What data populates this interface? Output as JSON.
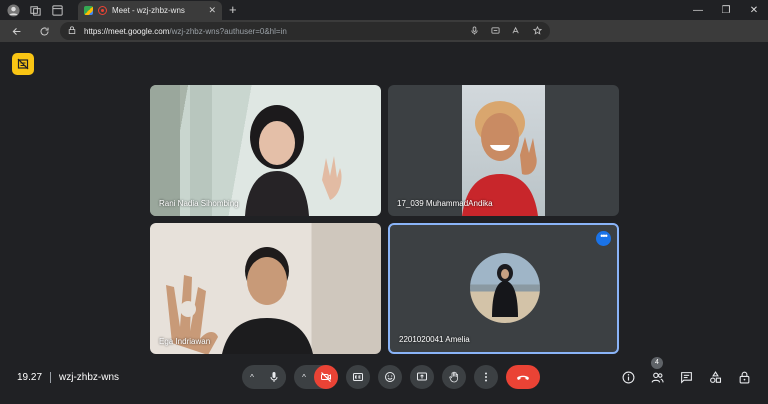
{
  "browser": {
    "tab": {
      "title": "Meet - wzj-zhbz-wns",
      "close": "✕"
    },
    "new_tab": "+",
    "window": {
      "minimize": "—",
      "maximize": "❐",
      "close": "✕"
    },
    "url_host": "https://meet.google.com",
    "url_rest": "/wzj-zhbz-wns?authuser=0&hl=in"
  },
  "participants": [
    {
      "name": "Rani Nadia Sihombing"
    },
    {
      "name": "17_039 MuhammadAndika"
    },
    {
      "name": "Ega Indriawan"
    },
    {
      "name": "2201020041 Amelia"
    }
  ],
  "tile_menu": "•••",
  "meeting": {
    "time": "19.27",
    "code": "wzj-zhbz-wns"
  },
  "people_count": "4",
  "colors": {
    "accent": "#1a73e8",
    "danger": "#ea4335",
    "badge": "#f9c514",
    "active_border": "#8ab4f8"
  },
  "icons": {
    "controls": [
      "mic-icon",
      "camera-off-icon",
      "captions-icon",
      "emoji-icon",
      "present-icon",
      "raise-hand-icon",
      "more-options-icon",
      "call-end-icon"
    ],
    "right": [
      "info-icon",
      "people-icon",
      "chat-icon",
      "activities-icon",
      "host-controls-icon"
    ]
  }
}
